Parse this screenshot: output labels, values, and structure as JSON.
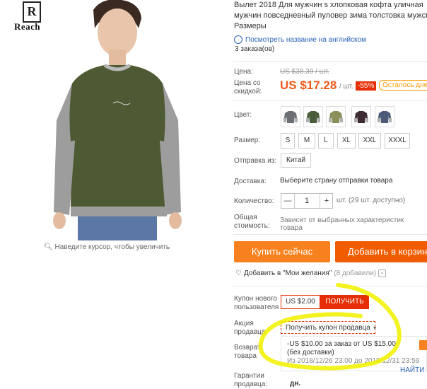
{
  "brand": {
    "logo_text": "Reach",
    "logo_monogram": "R"
  },
  "gallery": {
    "zoom_hint": "Наведите курсор, чтобы увеличить",
    "zoom_icon": "magnifier-icon"
  },
  "product": {
    "title": "Вылет 2018 Для мужчин s хлопковая кофта уличная мужчин повседневный пуловер зима толстовка мужск Размеры",
    "title_line1": "Вылет 2018 Для мужчин s хлопковая кофта уличная",
    "title_line2": "мужчин повседневный пуловер зима толстовка мужск",
    "title_line3": "Размеры",
    "translate_link": "Посмотреть название на английском",
    "orders": "3 заказа(ов)"
  },
  "price": {
    "label": "Цена:",
    "old": "US $38.39 / шт.",
    "discount_label": "Цена со скидкой:",
    "new": "US $17.28",
    "per_unit": "/ шт.",
    "discount_badge": "-55%",
    "remaining": "Осталось дней"
  },
  "color": {
    "label": "Цвет:",
    "swatches": [
      "#6b6e73",
      "#4a5d3a",
      "#8b8f5a",
      "#3d2a33",
      "#4b5a78"
    ]
  },
  "size": {
    "label": "Размер:",
    "options": [
      "S",
      "M",
      "L",
      "XL",
      "XXL",
      "XXXL"
    ]
  },
  "ship_from": {
    "label": "Отправка из:",
    "value": "Китай"
  },
  "delivery": {
    "label": "Доставка:",
    "value": "Выберите страну отправки товара"
  },
  "quantity": {
    "label": "Количество:",
    "minus": "—",
    "value": "1",
    "plus": "+",
    "available": "шт. (29 шт. доступно)"
  },
  "total": {
    "label_line1": "Общая",
    "label_line2": "стоимость:",
    "value": "Зависит от выбранных характеристик товара"
  },
  "actions": {
    "buy_now": "Купить сейчас",
    "add_to_cart": "Добавить в корзин"
  },
  "wishlist": {
    "label": "Добавить в \"Мои желания\"",
    "count": "(8 добавили)"
  },
  "new_user_coupon": {
    "label_line1": "Купон нового",
    "label_line2": "пользователя",
    "value": "US $2.00",
    "button": "ПОЛУЧИТЬ"
  },
  "seller_promo": {
    "label_line1": "Акция",
    "label_line2": "продавца:",
    "dropdown": "Получить купон продавца",
    "coupon_line1": "-US $10.00 за заказ от US $15.00",
    "coupon_line2": "(без доставки)",
    "dates": "Из 2018/12/26 23:00 до 2018/12/31 23:59",
    "find_more": "НАЙТИ ИЗБ"
  },
  "returns": {
    "label_line1": "Возврат",
    "label_line2": "товара"
  },
  "guarantee": {
    "label_line1": "Гарантии",
    "label_line2": "продавца:",
    "value": "дн."
  },
  "colors": {
    "accent": "#f05a1a",
    "buy": "#f7811e",
    "cart": "#f25c00",
    "badge": "#e62e04",
    "link": "#2a63b8",
    "highlight": "#f2f20a"
  }
}
